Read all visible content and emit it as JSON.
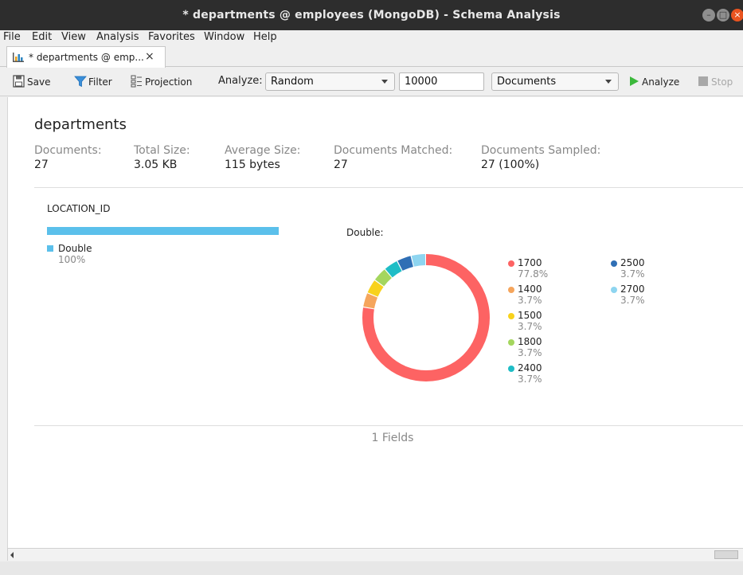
{
  "window": {
    "title": "* departments @ employees (MongoDB) - Schema Analysis"
  },
  "menu": {
    "file": "File",
    "edit": "Edit",
    "view": "View",
    "analysis": "Analysis",
    "favorites": "Favorites",
    "window": "Window",
    "help": "Help"
  },
  "tab": {
    "label": "* departments @ emp...",
    "close": "×"
  },
  "toolbar": {
    "save_label": "Save",
    "filter_label": "Filter",
    "projection_label": "Projection",
    "analyze_mode_label": "Analyze:",
    "mode_value": "Random",
    "sample_size": "10000",
    "target_value": "Documents",
    "analyze_label": "Analyze",
    "stop_label": "Stop"
  },
  "collection": {
    "name": "departments",
    "stats": [
      {
        "label": "Documents:",
        "value": "27"
      },
      {
        "label": "Total Size:",
        "value": "3.05 KB"
      },
      {
        "label": "Average Size:",
        "value": "115 bytes"
      },
      {
        "label": "Documents Matched:",
        "value": "27"
      },
      {
        "label": "Documents Sampled:",
        "value": "27 (100%)"
      }
    ]
  },
  "field": {
    "name": "LOCATION_ID",
    "types": [
      {
        "name": "Double",
        "percent": "100%",
        "fraction": 1.0,
        "color": "#5bc0eb"
      }
    ],
    "distribution_title": "Double:",
    "distribution": [
      {
        "value": "1700",
        "percent": "77.8%",
        "fraction": 0.778,
        "color": "#fd6363"
      },
      {
        "value": "1400",
        "percent": "3.7%",
        "fraction": 0.037,
        "color": "#f5a55c"
      },
      {
        "value": "1500",
        "percent": "3.7%",
        "fraction": 0.037,
        "color": "#f8d21c"
      },
      {
        "value": "1800",
        "percent": "3.7%",
        "fraction": 0.037,
        "color": "#a4d65e"
      },
      {
        "value": "2400",
        "percent": "3.7%",
        "fraction": 0.037,
        "color": "#1fbdc6"
      },
      {
        "value": "2500",
        "percent": "3.7%",
        "fraction": 0.037,
        "color": "#2f6fb5"
      },
      {
        "value": "2700",
        "percent": "3.7%",
        "fraction": 0.037,
        "color": "#8ed5f0"
      }
    ]
  },
  "footer": {
    "fields_count": "1 Fields"
  }
}
